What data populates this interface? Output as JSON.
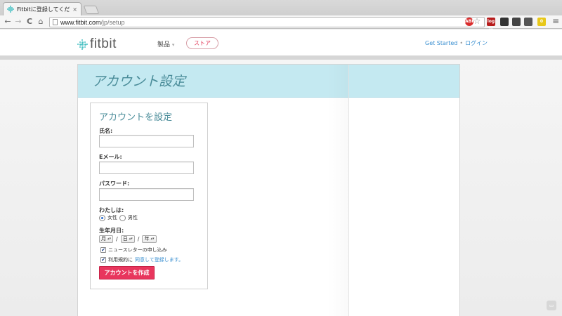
{
  "browser": {
    "tab_title": "Fitbitに登録してください！",
    "tab_close": "×",
    "url_host": "www.fitbit.com",
    "url_path": "/jp/setup",
    "back_icon": "←",
    "forward_icon": "→",
    "reload_icon": "C",
    "home_icon": "⌂",
    "star_icon": "☆",
    "menu_icon": "≡",
    "extensions": [
      {
        "name": "abp-extension-icon",
        "label": "ABP",
        "color": "#d92c2c"
      },
      {
        "name": "login-extension-icon",
        "label": "log in",
        "color": "#b71c1c"
      },
      {
        "name": "evernote-extension-icon",
        "label": "",
        "color": "#333333"
      },
      {
        "name": "grid-extension-icon",
        "label": "",
        "color": "#444444"
      },
      {
        "name": "notes-extension-icon",
        "label": "",
        "color": "#555555"
      },
      {
        "name": "sticky-extension-icon",
        "label": "0",
        "color": "#e8c81a"
      }
    ]
  },
  "site": {
    "logo_text": "fitbit",
    "nav_products": "製品",
    "nav_products_caret": "▾",
    "nav_store": "ストア",
    "nav_get_started": "Get Started",
    "nav_separator": "•",
    "nav_login": "ログイン"
  },
  "banner": {
    "title": "アカウント設定"
  },
  "form": {
    "title": "アカウントを設定",
    "name_label": "氏名:",
    "email_label": "Eメール:",
    "password_label": "パスワード:",
    "gender_label": "わたしは:",
    "gender_female": "女性",
    "gender_male": "男性",
    "gender_selected": "female",
    "dob_label": "生年月日:",
    "dob_month": "月",
    "dob_day": "日",
    "dob_year": "年",
    "dob_separator": "/",
    "newsletter_label": "ニュースレターの申し込み",
    "newsletter_checked": true,
    "terms_prefix": "利用規約に",
    "terms_link": "同意して登録します。",
    "terms_checked": true,
    "submit_label": "アカウントを作成",
    "check_glyph": "✔"
  },
  "colors": {
    "accent_teal": "#4cc2c4",
    "banner_bg": "#c4e9f1",
    "title_teal": "#4a8c99",
    "store_red": "#e23b5a",
    "submit_bg": "#e8365d",
    "link_blue": "#3a8fd0"
  }
}
